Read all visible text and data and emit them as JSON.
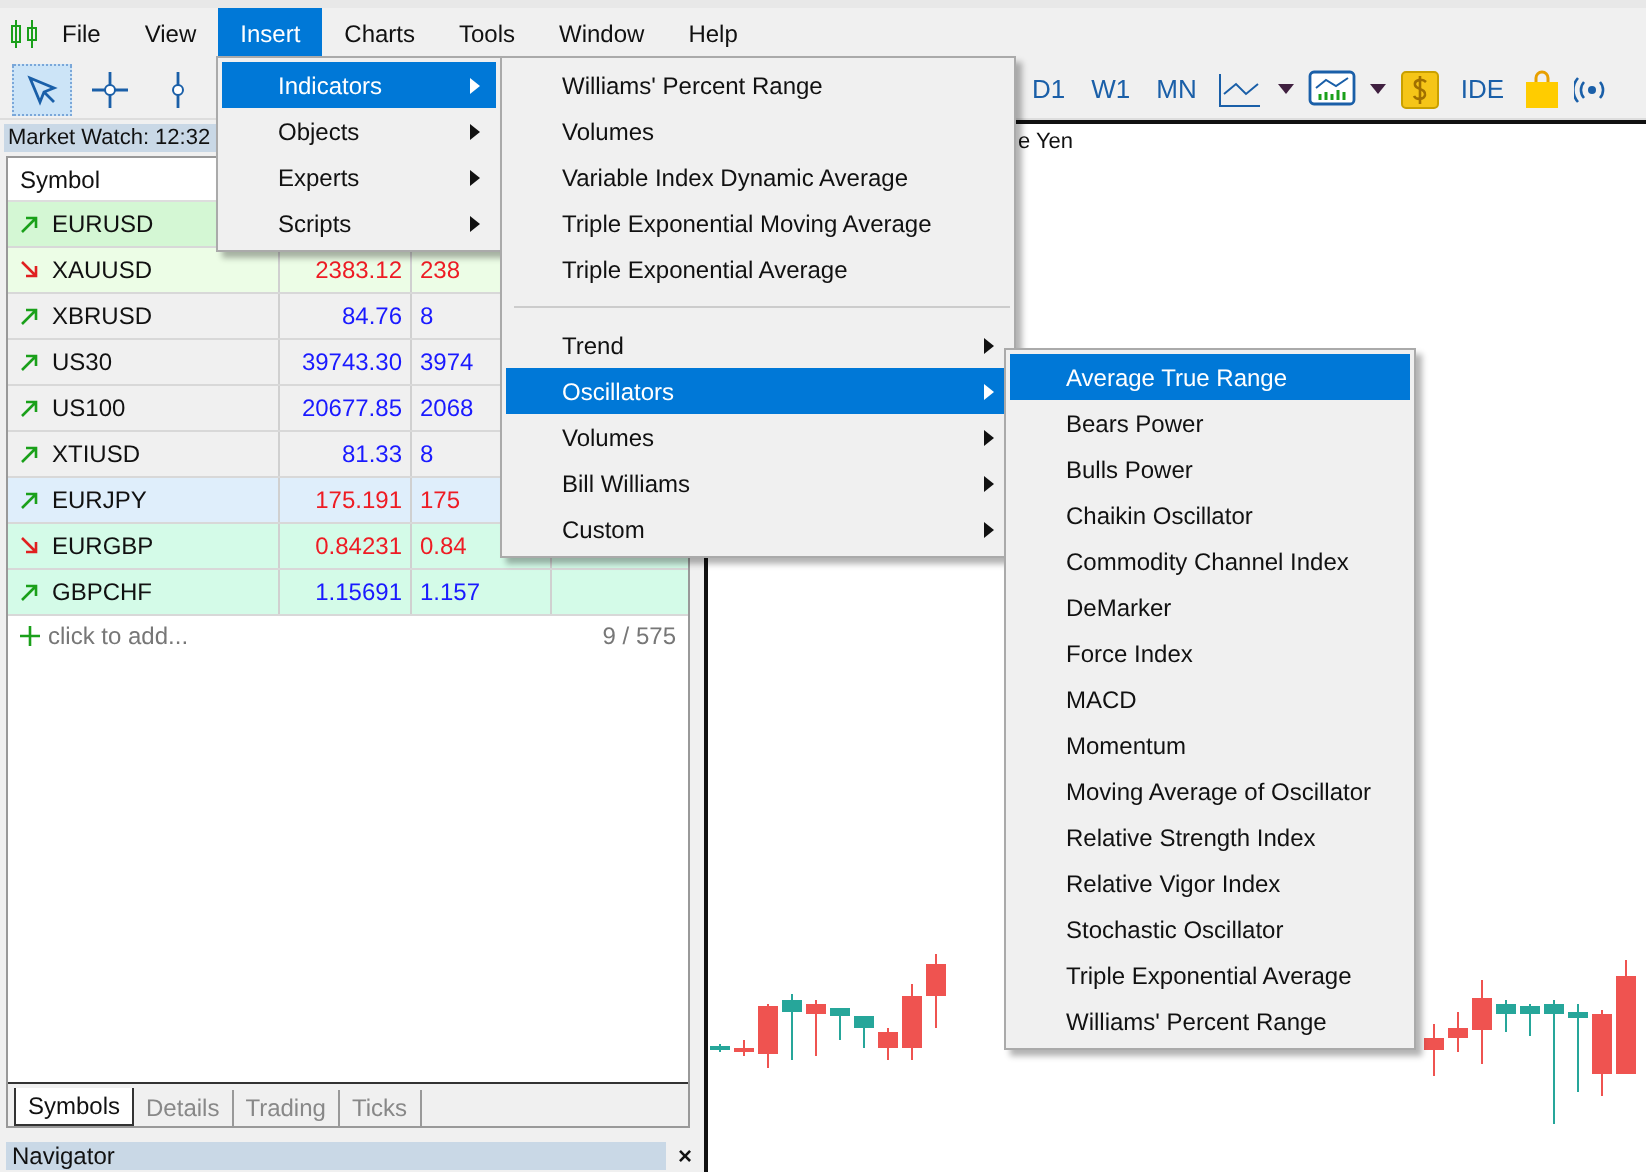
{
  "menubar": {
    "items": [
      {
        "label": "File",
        "selected": false
      },
      {
        "label": "View",
        "selected": false
      },
      {
        "label": "Insert",
        "selected": true
      },
      {
        "label": "Charts",
        "selected": false
      },
      {
        "label": "Tools",
        "selected": false
      },
      {
        "label": "Window",
        "selected": false
      },
      {
        "label": "Help",
        "selected": false
      }
    ]
  },
  "toolbar": {
    "tools": [
      {
        "kind": "arrow",
        "selected": true
      },
      {
        "kind": "crosshair",
        "selected": false
      },
      {
        "kind": "vline",
        "selected": false
      }
    ],
    "timeframes": [
      "D1",
      "W1",
      "MN"
    ],
    "ide": "IDE"
  },
  "market_watch": {
    "title": "Market Watch: 12:32",
    "column_1": "Symbol",
    "rows": [
      {
        "symbol": "EURUSD",
        "up": true,
        "color": "#d4f7d4"
      },
      {
        "symbol": "XAUUSD",
        "up": false,
        "color": "#ecfde6",
        "bid": "2383.12",
        "ask": "238",
        "rising": false
      },
      {
        "symbol": "XBRUSD",
        "up": true,
        "color": "#f0f0f0",
        "bid": "84.76",
        "ask": "8",
        "rising": true
      },
      {
        "symbol": "US30",
        "up": true,
        "color": "#f0f0f0",
        "bid": "39743.30",
        "ask": "3974",
        "rising": true
      },
      {
        "symbol": "US100",
        "up": true,
        "color": "#f0f0f0",
        "bid": "20677.85",
        "ask": "2068",
        "rising": true
      },
      {
        "symbol": "XTIUSD",
        "up": true,
        "color": "#f0f0f0",
        "bid": "81.33",
        "ask": "8",
        "rising": true
      },
      {
        "symbol": "EURJPY",
        "up": true,
        "color": "#dfeefb",
        "bid": "175.191",
        "ask": "175",
        "rising": false
      },
      {
        "symbol": "EURGBP",
        "up": false,
        "color": "#d4fbe8",
        "bid": "0.84231",
        "ask": "0.84",
        "rising": false
      },
      {
        "symbol": "GBPCHF",
        "up": true,
        "color": "#d4fbe8",
        "bid": "1.15691",
        "ask": "1.157",
        "rising": true
      }
    ],
    "add": "click to add...",
    "count": "9 / 575",
    "tabs": [
      {
        "label": "Symbols",
        "selected": true
      },
      {
        "label": "Details",
        "selected": false
      },
      {
        "label": "Trading",
        "selected": false
      },
      {
        "label": "Ticks",
        "selected": false
      }
    ]
  },
  "navigator": {
    "title": "Navigator",
    "close": "×"
  },
  "chart": {
    "title": "e Yen"
  },
  "insert_menu": [
    {
      "label": "Indicators",
      "selected": true
    },
    {
      "label": "Objects",
      "selected": false
    },
    {
      "label": "Experts",
      "selected": false
    },
    {
      "label": "Scripts",
      "selected": false
    }
  ],
  "indicators_menu": [
    {
      "label": "Williams' Percent Range",
      "kind": "item",
      "selected": false
    },
    {
      "label": "Volumes",
      "kind": "item",
      "selected": false
    },
    {
      "label": "Variable Index Dynamic Average",
      "kind": "item",
      "selected": false
    },
    {
      "label": "Triple Exponential Moving Average",
      "kind": "item",
      "selected": false
    },
    {
      "label": "Triple Exponential Average",
      "kind": "item",
      "selected": false
    },
    {
      "kind": "separator"
    },
    {
      "label": "Trend",
      "kind": "submenu",
      "selected": false
    },
    {
      "label": "Oscillators",
      "kind": "submenu",
      "selected": true
    },
    {
      "label": "Volumes",
      "kind": "submenu",
      "selected": false
    },
    {
      "label": "Bill Williams",
      "kind": "submenu",
      "selected": false
    },
    {
      "label": "Custom",
      "kind": "submenu",
      "selected": false
    }
  ],
  "oscillators_menu": [
    {
      "label": "Average True Range",
      "selected": true
    },
    {
      "label": "Bears Power",
      "selected": false
    },
    {
      "label": "Bulls Power",
      "selected": false
    },
    {
      "label": "Chaikin Oscillator",
      "selected": false
    },
    {
      "label": "Commodity Channel Index",
      "selected": false
    },
    {
      "label": "DeMarker",
      "selected": false
    },
    {
      "label": "Force Index",
      "selected": false
    },
    {
      "label": "MACD",
      "selected": false
    },
    {
      "label": "Momentum",
      "selected": false
    },
    {
      "label": "Moving Average of Oscillator",
      "selected": false
    },
    {
      "label": "Relative Strength Index",
      "selected": false
    },
    {
      "label": "Relative Vigor Index",
      "selected": false
    },
    {
      "label": "Stochastic Oscillator",
      "selected": false
    },
    {
      "label": "Triple Exponential Average",
      "selected": false
    },
    {
      "label": "Williams' Percent Range",
      "selected": false
    }
  ]
}
